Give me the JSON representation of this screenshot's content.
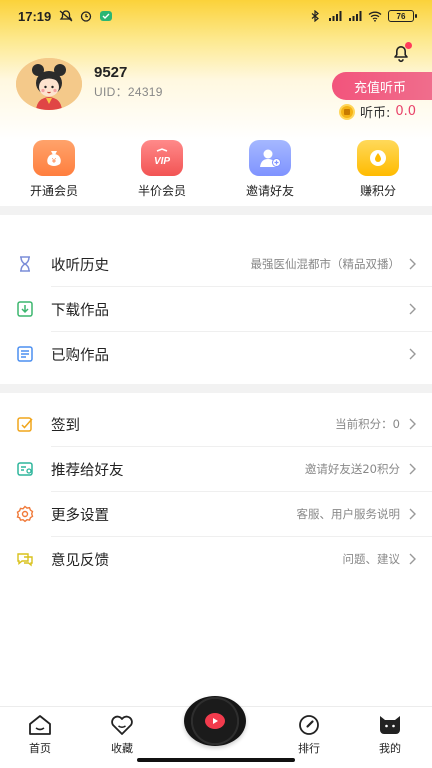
{
  "status_bar": {
    "time": "17:19",
    "battery": "76"
  },
  "profile": {
    "name": "9527",
    "uid": "UID：24319",
    "recharge_label": "充值听币",
    "coin_label": "听币:",
    "coin_value": "0.0"
  },
  "quick_actions": [
    {
      "label": "开通会员",
      "icon": "money-bag-icon",
      "color": "#ff8a4c"
    },
    {
      "label": "半价会员",
      "icon": "vip-icon",
      "color": "#f25a5a"
    },
    {
      "label": "邀请好友",
      "icon": "invite-user-icon",
      "color": "#8ea0ff"
    },
    {
      "label": "赚积分",
      "icon": "points-drop-icon",
      "color": "#ffc21a"
    }
  ],
  "list_group_1": [
    {
      "label": "收听历史",
      "hint": "最强医仙混都市（精品双播）",
      "icon": "hourglass-icon"
    },
    {
      "label": "下载作品",
      "hint": "",
      "icon": "download-icon"
    },
    {
      "label": "已购作品",
      "hint": "",
      "icon": "purchased-icon"
    }
  ],
  "list_group_2": [
    {
      "label": "签到",
      "hint": "当前积分：0",
      "icon": "checkin-icon"
    },
    {
      "label": "推荐给好友",
      "hint": "邀请好友送20积分",
      "icon": "share-icon"
    },
    {
      "label": "更多设置",
      "hint": "客服、用户服务说明",
      "icon": "settings-icon"
    },
    {
      "label": "意见反馈",
      "hint": "问题、建议",
      "icon": "feedback-icon"
    }
  ],
  "tabbar": {
    "home": "首页",
    "favorites": "收藏",
    "ranking": "排行",
    "mine": "我的"
  },
  "colors": {
    "accent": "#f2547c",
    "header_yellow": "#fbd23a",
    "coin_value": "#e8436a"
  }
}
